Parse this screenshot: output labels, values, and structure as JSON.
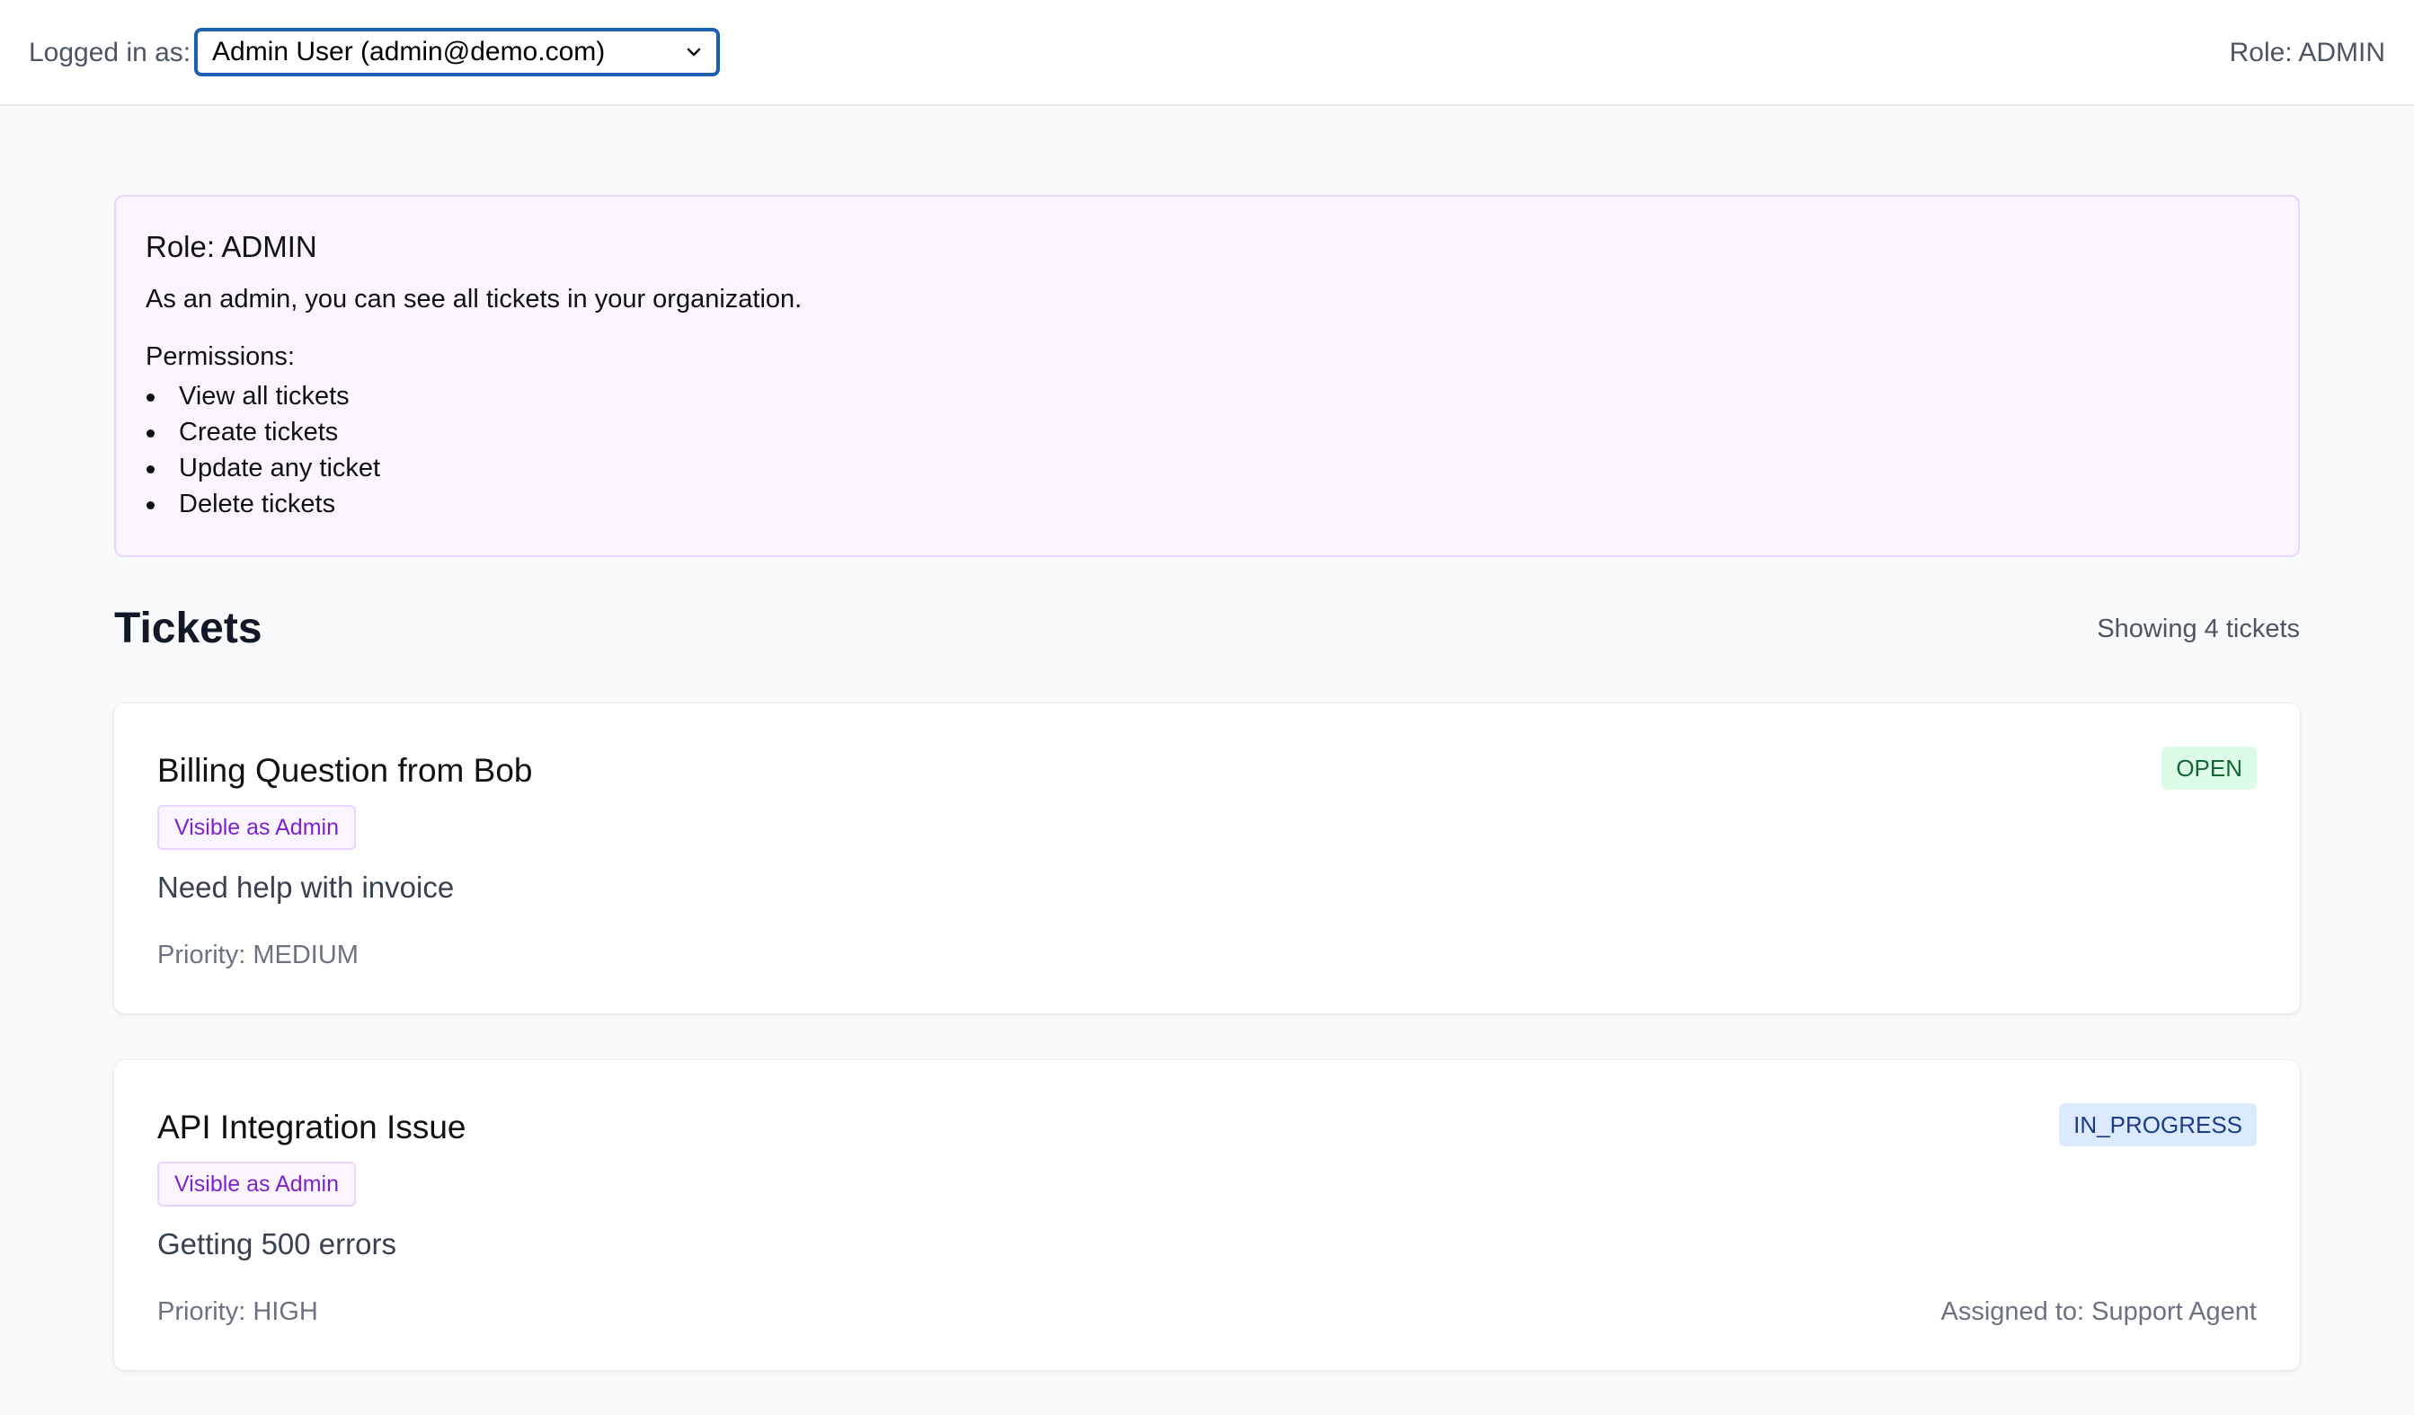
{
  "header": {
    "login_label": "Logged in as:",
    "user_select_value": "Admin User (admin@demo.com)",
    "role_label": "Role: ADMIN"
  },
  "role_panel": {
    "title": "Role: ADMIN",
    "description": "As an admin, you can see all tickets in your organization.",
    "permissions_label": "Permissions:",
    "permissions": [
      "View all tickets",
      "Create tickets",
      "Update any ticket",
      "Delete tickets"
    ]
  },
  "tickets": {
    "heading": "Tickets",
    "count_text": "Showing 4 tickets",
    "items": [
      {
        "title": "Billing Question from Bob",
        "visibility": "Visible as Admin",
        "description": "Need help with invoice",
        "priority": "Priority: MEDIUM",
        "status": "OPEN",
        "assigned": ""
      },
      {
        "title": "API Integration Issue",
        "visibility": "Visible as Admin",
        "description": "Getting 500 errors",
        "priority": "Priority: HIGH",
        "status": "IN_PROGRESS",
        "assigned": "Assigned to: Support Agent"
      }
    ]
  },
  "colors": {
    "select_border": "#1a5fb4",
    "role_panel_bg": "#faf5ff",
    "visibility_badge_text": "#7e22ce",
    "status_open_bg": "#dcfce7",
    "status_in_progress_bg": "#dbeafe"
  },
  "icons": {
    "select_chevron": "chevron-down-icon"
  }
}
